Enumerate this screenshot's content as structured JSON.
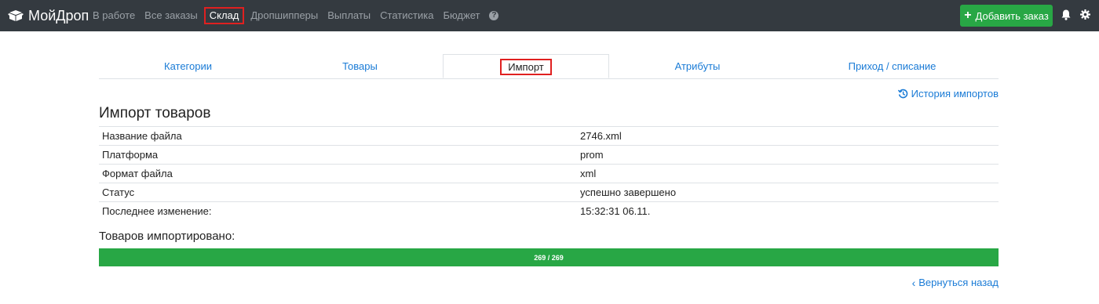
{
  "navbar": {
    "brand": "МойДроп",
    "items": [
      {
        "label": "В работе",
        "active": false
      },
      {
        "label": "Все заказы",
        "active": false
      },
      {
        "label": "Склад",
        "active": true
      },
      {
        "label": "Дропшипперы",
        "active": false
      },
      {
        "label": "Выплаты",
        "active": false
      },
      {
        "label": "Статистика",
        "active": false
      },
      {
        "label": "Бюджет",
        "active": false
      }
    ],
    "help_icon": "question-circle-icon",
    "add_order_label": "Добавить заказ",
    "add_order_color": "#28a745",
    "bell_icon": "bell-icon",
    "settings_icon": "gear-icon"
  },
  "tabs": [
    {
      "label": "Категории",
      "active": false
    },
    {
      "label": "Товары",
      "active": false
    },
    {
      "label": "Импорт",
      "active": true
    },
    {
      "label": "Атрибуты",
      "active": false
    },
    {
      "label": "Приход / списание",
      "active": false
    }
  ],
  "history_link": "История импортов",
  "page_title": "Импорт товаров",
  "info_rows": [
    {
      "key": "Название файла",
      "value": "2746.xml"
    },
    {
      "key": "Платформа",
      "value": "prom"
    },
    {
      "key": "Формат файла",
      "value": "xml"
    },
    {
      "key": "Статус",
      "value": "успешно завершено"
    },
    {
      "key": "Последнее изменение:",
      "value": "15:32:31 06.11."
    }
  ],
  "imported_title": "Товаров импортировано:",
  "progress": {
    "label": "269 / 269",
    "fraction": 1.0,
    "color": "#28a745"
  },
  "back_link": "Вернуться назад",
  "accent_color": "#1a7bd6"
}
